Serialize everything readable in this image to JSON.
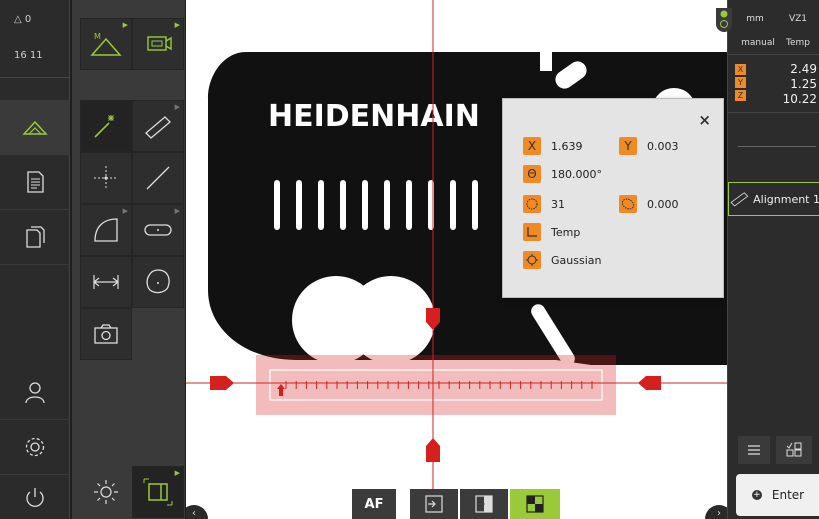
{
  "status": {
    "counter": "△ 0",
    "time": "16 11"
  },
  "main_menu": [
    "measure",
    "measure-report",
    "file-management",
    "user-login",
    "settings",
    "switch-off"
  ],
  "tool_palette": {
    "top_tools": [
      "manual-measure",
      "video-sensor"
    ],
    "tools": [
      "alignment",
      "line",
      "point",
      "line-2",
      "arc",
      "slot",
      "distance",
      "circle",
      "camera"
    ]
  },
  "popup": {
    "x_label": "X",
    "x_value": "1.639",
    "y_label": "Y",
    "y_value": "0.003",
    "theta_label": "Θ",
    "theta_value": "180.000°",
    "points_value": "31",
    "form_value": "0.000",
    "coord_system": "Temp",
    "filter": "Gaussian",
    "close_label": "×"
  },
  "image_text": {
    "brand": "HEIDENHAIN"
  },
  "bottom_toolbar": {
    "af_label": "AF"
  },
  "inspector": {
    "units": "mm",
    "zero_point": "VZ1",
    "mode": "manual",
    "coord_system": "Temp",
    "axes": [
      {
        "label": "X",
        "value": "2.49"
      },
      {
        "label": "Y",
        "value": "1.25"
      },
      {
        "label": "Z",
        "value": "10.22"
      }
    ],
    "feature_label": "Alignment 1",
    "enter_label": "Enter"
  },
  "colors": {
    "accent_orange": "#f08a24",
    "accent_green": "#9ac93a",
    "crosshair_red": "#d62020"
  }
}
